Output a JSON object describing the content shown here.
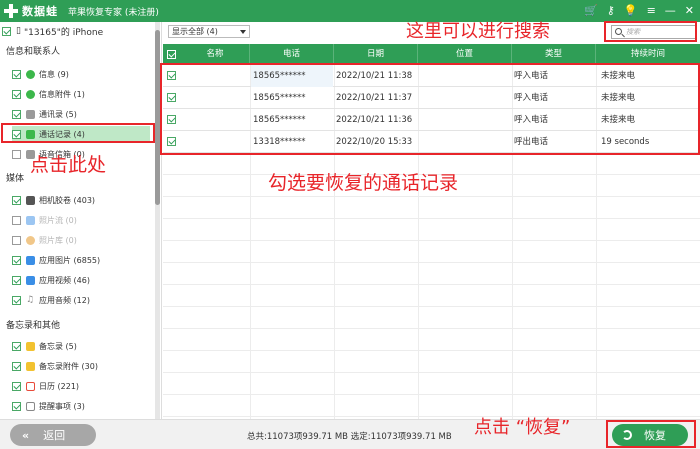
{
  "titlebar": {
    "brand": "数据蛙",
    "title": "苹果恢复专家 (未注册)",
    "icons": [
      "cart-icon",
      "key-icon",
      "bulb-icon",
      "menu-icon",
      "minimize-icon",
      "close-icon"
    ]
  },
  "sidebar": {
    "device": "\"13165\"的 iPhone",
    "sections": [
      {
        "label": "信息和联系人",
        "items": [
          {
            "label": "信息 (9)",
            "checked": true,
            "icon": "message-icon",
            "color": "#3cb84b"
          },
          {
            "label": "信息附件 (1)",
            "checked": true,
            "icon": "attachment-icon",
            "color": "#3cb84b"
          },
          {
            "label": "通讯录 (5)",
            "checked": true,
            "icon": "contacts-icon",
            "color": "#9a9a9a"
          },
          {
            "label": "通话记录 (4)",
            "checked": true,
            "icon": "phone-icon",
            "color": "#3cb84b",
            "selected": true
          },
          {
            "label": "语音信箱 (0)",
            "checked": false,
            "icon": "voicemail-icon",
            "color": "#9a9a9a"
          }
        ]
      },
      {
        "label": "媒体",
        "items": [
          {
            "label": "相机胶卷 (403)",
            "checked": true,
            "icon": "camera-icon",
            "color": "#555555"
          },
          {
            "label": "照片流 (0)",
            "checked": false,
            "icon": "photostream-icon",
            "color": "#3a8ee6",
            "disabled": true
          },
          {
            "label": "照片库 (0)",
            "checked": false,
            "icon": "photos-icon",
            "color": "#e8a23a",
            "disabled": true
          },
          {
            "label": "应用图片 (6855)",
            "checked": true,
            "icon": "app-photo-icon",
            "color": "#3a8ee6"
          },
          {
            "label": "应用视频 (46)",
            "checked": true,
            "icon": "app-video-icon",
            "color": "#3a8ee6"
          },
          {
            "label": "应用音频 (12)",
            "checked": true,
            "icon": "app-audio-icon",
            "color": "#888888"
          }
        ]
      },
      {
        "label": "备忘录和其他",
        "items": [
          {
            "label": "备忘录 (5)",
            "checked": true,
            "icon": "notes-icon",
            "color": "#f2c230"
          },
          {
            "label": "备忘录附件 (30)",
            "checked": true,
            "icon": "notes-attachment-icon",
            "color": "#f2c230"
          },
          {
            "label": "日历 (221)",
            "checked": true,
            "icon": "calendar-icon",
            "color": "#e84a3a"
          },
          {
            "label": "提醒事项 (3)",
            "checked": true,
            "icon": "reminders-icon",
            "color": "#888888"
          }
        ]
      }
    ]
  },
  "toolbar": {
    "filter_value": "显示全部 (4)",
    "search_placeholder": "搜索"
  },
  "table": {
    "columns": [
      "名称",
      "电话",
      "日期",
      "位置",
      "类型",
      "持续时间"
    ],
    "rows": [
      {
        "name": "",
        "phone": "18565******",
        "date": "2022/10/21 11:38",
        "location": "",
        "type": "呼入电话",
        "duration": "未接来电"
      },
      {
        "name": "",
        "phone": "18565******",
        "date": "2022/10/21 11:37",
        "location": "",
        "type": "呼入电话",
        "duration": "未接来电"
      },
      {
        "name": "",
        "phone": "18565******",
        "date": "2022/10/21 11:36",
        "location": "",
        "type": "呼入电话",
        "duration": "未接来电"
      },
      {
        "name": "",
        "phone": "13318******",
        "date": "2022/10/20 15:33",
        "location": "",
        "type": "呼出电话",
        "duration": "19 seconds"
      }
    ]
  },
  "bottombar": {
    "back_label": "返回",
    "totals": "总共:11073项939.71 MB 选定:11073项939.71 MB",
    "restore_label": "恢复"
  },
  "annotations": {
    "search_hint": "这里可以进行搜索",
    "click_here": "点击此处",
    "select_hint": "勾选要恢复的通话记录",
    "click_restore": "点击 “恢复”",
    "color": "#e8252a"
  },
  "colors": {
    "brand_green": "#2f9e56",
    "selected_bg": "#bfe8c7",
    "annotation_red": "#e8252a"
  }
}
